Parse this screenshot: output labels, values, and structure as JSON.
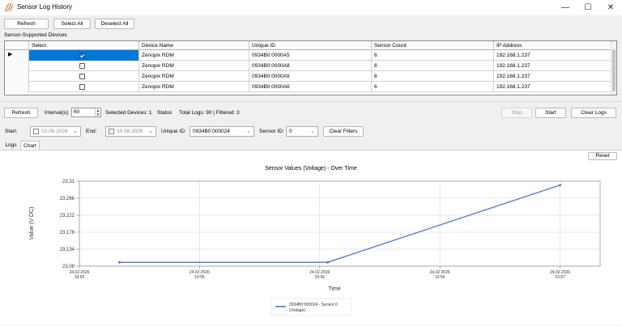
{
  "window": {
    "title": "Sensor Log History",
    "controls": [
      "—",
      "☐",
      "✕"
    ]
  },
  "toolbar": {
    "refresh": "Refresh",
    "select_all": "Select All",
    "deselect_all": "Deselect All"
  },
  "devices": {
    "label": "Sensor-Supported Devices",
    "columns": [
      "Select",
      "Device Name",
      "Unique ID",
      "Sensor Count",
      "IP Address"
    ],
    "rows": [
      {
        "selected": true,
        "device": "Zenopix RDM",
        "uid": "0934B0:0000A5",
        "count": "6",
        "ip": "192.168.1.237"
      },
      {
        "selected": false,
        "device": "Zenopix RDM",
        "uid": "0934B0:0000A8",
        "count": "6",
        "ip": "192.168.1.237"
      },
      {
        "selected": false,
        "device": "Zenopix RDM",
        "uid": "0934B0:0000A9",
        "count": "6",
        "ip": "192.168.1.237"
      },
      {
        "selected": false,
        "device": "Zenopix RDM",
        "uid": "0934B0:0000A6",
        "count": "6",
        "ip": "192.168.1.237"
      }
    ]
  },
  "controls": {
    "refresh": "Refresh",
    "interval_label": "Interval(s):",
    "interval_value": "60",
    "selected_devices": "Selected Devices: 1",
    "status_label": "Status",
    "total_logs": "Total Logs: 90 | Filtered: 3",
    "stop": "Stop",
    "start": "Start",
    "clear_logs": "Clear Logs"
  },
  "filters": {
    "start_label": "Start:",
    "start_value": "10.08.2026",
    "end_label": "End:",
    "end_value": "10.08.2026",
    "uid_label": "Unique ID:",
    "uid_value": "0934B0:000024",
    "sensor_label": "Sensor ID:",
    "sensor_value": "0",
    "clear_filters": "Clear Filters"
  },
  "tabs": {
    "logs": "Logs",
    "chart": "Chart"
  },
  "reset_label": "Reset",
  "colors": {
    "series": "#4169e1",
    "selection": "#0078d7"
  },
  "chart_data": {
    "type": "line",
    "title": "Sensor Values (Voltage) - Over Time",
    "xlabel": "Time",
    "ylabel": "Value (V DC)",
    "ylim": [
      23.09,
      23.31
    ],
    "yticks": [
      "23,31",
      "23,266",
      "23,222",
      "23,178",
      "23,134",
      "23,09"
    ],
    "xticks": [
      {
        "line1": "24.02.2026",
        "line2": "10:55"
      },
      {
        "line1": "24.02.2026",
        "line2": "10:55"
      },
      {
        "line1": "24.02.2026",
        "line2": "10:56"
      },
      {
        "line1": "24.02.2026",
        "line2": "10:56"
      },
      {
        "line1": "24.02.2026",
        "line2": "10:57"
      }
    ],
    "grid": true,
    "legend_position": "bottom",
    "series": [
      {
        "name_line1": "0934B0:000024 - Sensor 0",
        "name_line2": "(Voltage)",
        "x_minutes": [
          0.25,
          1.55,
          3.0
        ],
        "values": [
          23.1,
          23.1,
          23.3
        ]
      }
    ]
  }
}
